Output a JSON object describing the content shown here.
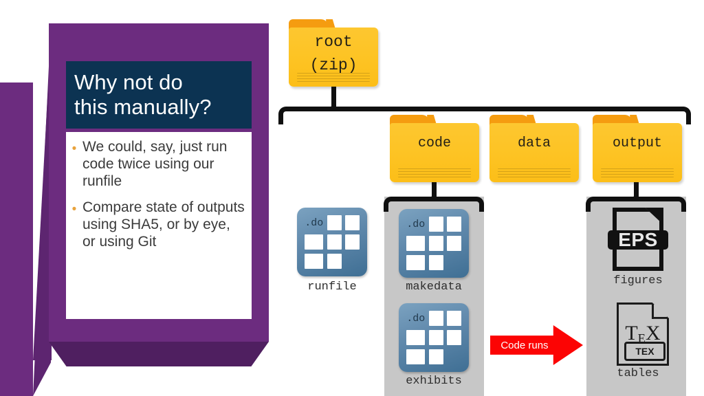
{
  "slide": {
    "title": "Why not do\nthis manually?",
    "bullets": [
      "We could, say, just run code twice using our runfile",
      "Compare state of outputs using SHA5, or by eye, or using Git"
    ],
    "bullet_glyph": "•",
    "colors": {
      "panel_purple": "#6c2c7f",
      "panel_purple_dark": "#5d2570",
      "title_navy": "#0c3352",
      "bullet_gold": "#e8a33d",
      "body_white": "#ffffff"
    }
  },
  "diagram": {
    "root_folder": {
      "label": "root\n(zip)"
    },
    "folders": [
      {
        "label": "code"
      },
      {
        "label": "data"
      },
      {
        "label": "output"
      }
    ],
    "files": [
      {
        "caption": "runfile",
        "badge": ".do"
      },
      {
        "caption": "makedata",
        "badge": ".do"
      },
      {
        "caption": "exhibits",
        "badge": ".do"
      }
    ],
    "outputs": [
      {
        "caption": "figures",
        "badge": "EPS"
      },
      {
        "caption": "tables",
        "badge": "TEX",
        "glyph_t": "T",
        "glyph_e": "E",
        "glyph_x": "X"
      }
    ],
    "arrow": {
      "label": "Code runs",
      "color": "#fc0404"
    },
    "colors": {
      "folder_body": "#fdc323",
      "folder_tab": "#f59c10",
      "file_chip": "#5f88ab",
      "gray_panel": "#c7c7c7",
      "connector": "#101010"
    }
  }
}
